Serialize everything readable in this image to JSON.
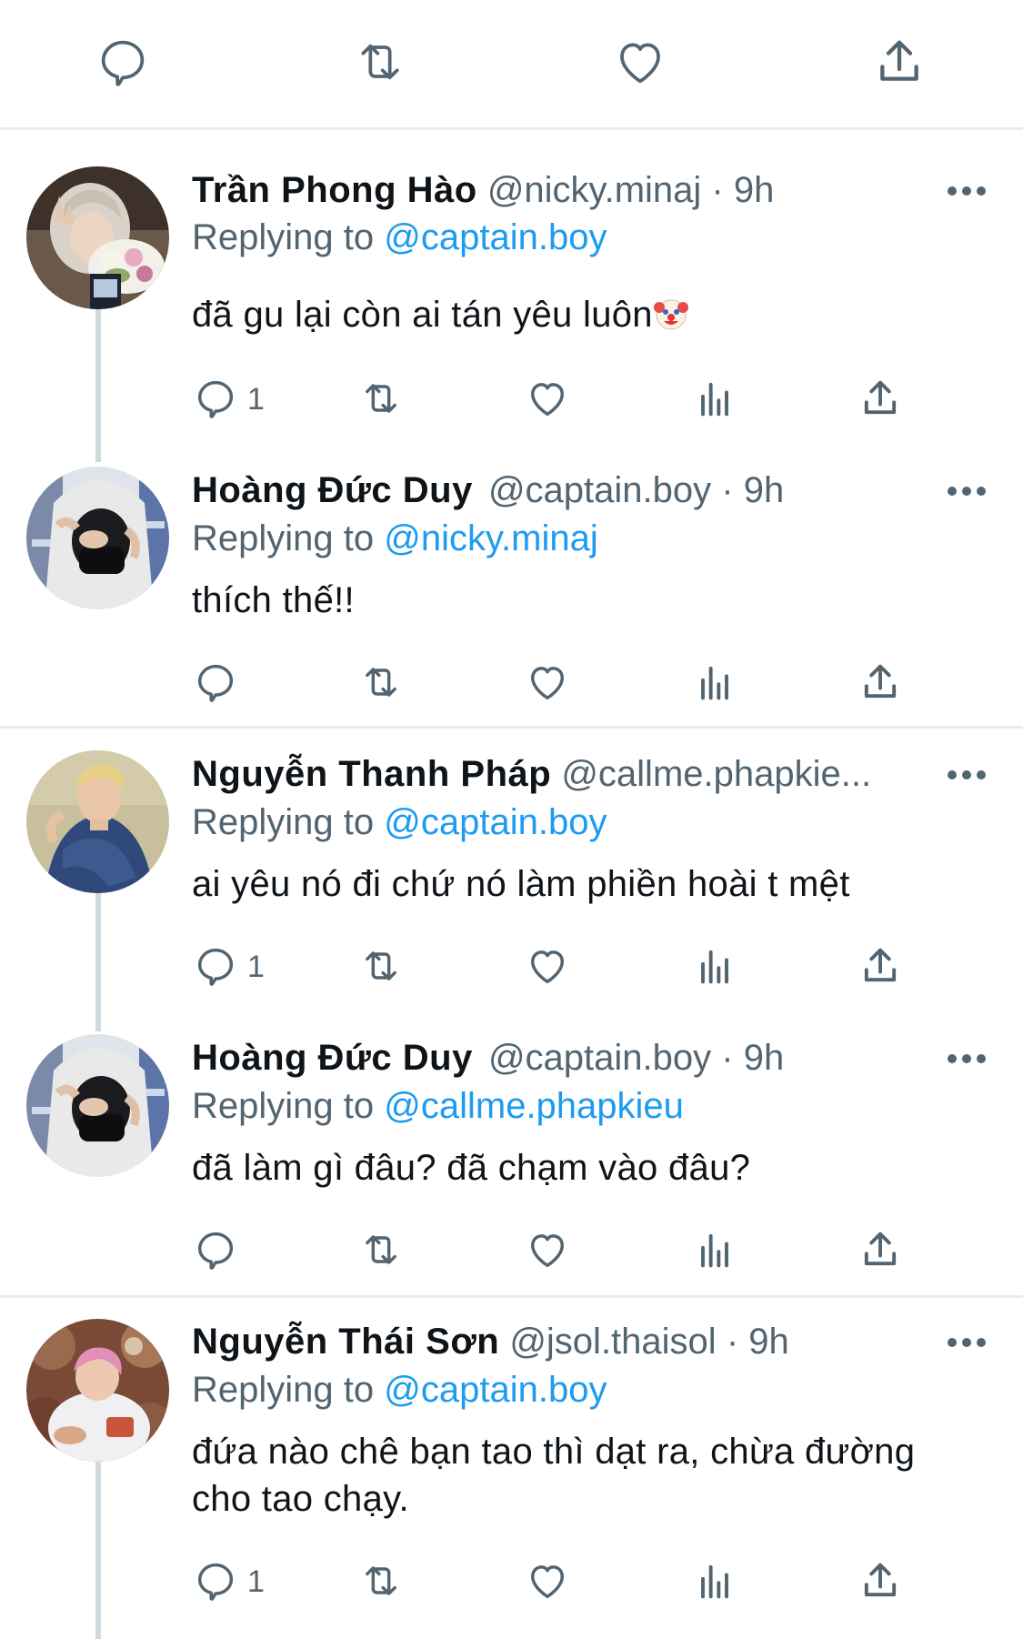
{
  "colors": {
    "accent": "#1d9bf0",
    "muted": "#536471",
    "text": "#0f1419",
    "divider": "#e6ecf0"
  },
  "top_actions": [
    {
      "icon": "reply-icon"
    },
    {
      "icon": "retweet-icon"
    },
    {
      "icon": "like-icon"
    },
    {
      "icon": "share-icon"
    }
  ],
  "tweets": [
    {
      "name": "Trần Phong Hào",
      "handle": "@nicky.minaj",
      "separator": "·",
      "time": "9h",
      "replying_label": "Replying to",
      "replying_to": "@captain.boy",
      "text": "đã gu lại còn ai tán yêu luôn",
      "emoji": "clown-face",
      "reply_count": "1"
    },
    {
      "name": "Hoàng Đức Duy",
      "handle": "@captain.boy",
      "separator": "·",
      "time": "9h",
      "replying_label": "Replying to",
      "replying_to": "@nicky.minaj",
      "text": "thích thế!!",
      "reply_count": ""
    },
    {
      "name": "Nguyễn Thanh Pháp",
      "handle": "@callme.phapkie...",
      "separator": "",
      "time": "",
      "replying_label": "Replying to",
      "replying_to": "@captain.boy",
      "text": "ai yêu nó đi chứ nó làm phiền hoài t mệt",
      "reply_count": "1"
    },
    {
      "name": "Hoàng Đức Duy",
      "handle": "@captain.boy",
      "separator": "·",
      "time": "9h",
      "replying_label": "Replying to",
      "replying_to": "@callme.phapkieu",
      "text": "đã làm gì đâu? đã chạm vào đâu?",
      "reply_count": ""
    },
    {
      "name": "Nguyễn Thái Sơn",
      "handle": "@jsol.thaisol",
      "separator": "·",
      "time": "9h",
      "replying_label": "Replying to",
      "replying_to": "@captain.boy",
      "text": "đứa nào chê bạn tao thì dạt ra, chừa đường cho tao chạy.",
      "reply_count": "1"
    }
  ]
}
